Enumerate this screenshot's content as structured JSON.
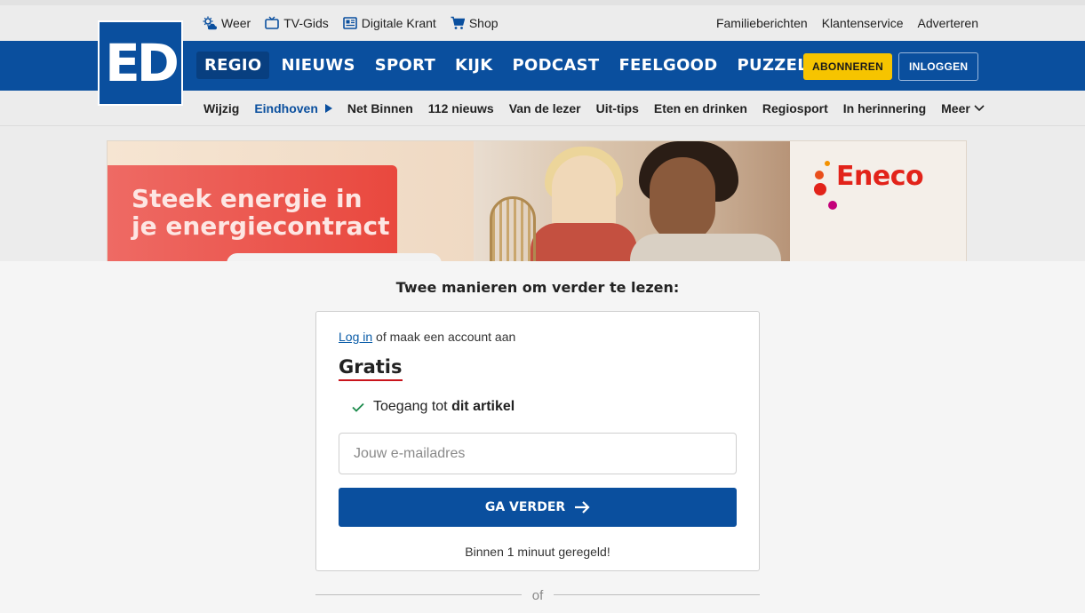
{
  "topbar": {
    "left": [
      {
        "icon": "weather-icon",
        "label": "Weer"
      },
      {
        "icon": "tv-icon",
        "label": "TV-Gids"
      },
      {
        "icon": "newspaper-icon",
        "label": "Digitale Krant"
      },
      {
        "icon": "cart-icon",
        "label": "Shop"
      }
    ],
    "right": [
      "Familieberichten",
      "Klantenservice",
      "Adverteren"
    ]
  },
  "logo": {
    "text": "ED"
  },
  "mainnav": {
    "items": [
      "REGIO",
      "NIEUWS",
      "SPORT",
      "KIJK",
      "PODCAST",
      "FEELGOOD",
      "PUZZEL"
    ],
    "active": "REGIO",
    "subscribe_label": "ABONNEREN",
    "login_label": "INLOGGEN"
  },
  "subnav": {
    "change_label": "Wijzig",
    "region": "Eindhoven",
    "items": [
      "Net Binnen",
      "112 nieuws",
      "Van de lezer",
      "Uit-tips",
      "Eten en drinken",
      "Regiosport",
      "In herinnering"
    ],
    "more_label": "Meer"
  },
  "ad": {
    "headline_line1": "Steek energie in",
    "headline_line2": "je energiecontract",
    "brand": "Eneco"
  },
  "paywall": {
    "title": "Twee manieren om verder te lezen:",
    "login_link": "Log in",
    "login_rest": "of maak een account aan",
    "plan_name": "Gratis",
    "feature_prefix": "Toegang tot",
    "feature_bold": "dit artikel",
    "email_placeholder": "Jouw e-mailadres",
    "continue_label": "GA VERDER",
    "note": "Binnen 1 minuut geregeld!",
    "or_label": "of"
  },
  "colors": {
    "brand_blue": "#0a4f9e",
    "subscribe_yellow": "#f6c400",
    "accent_red": "#c9141c",
    "check_green": "#1a8a4a"
  }
}
